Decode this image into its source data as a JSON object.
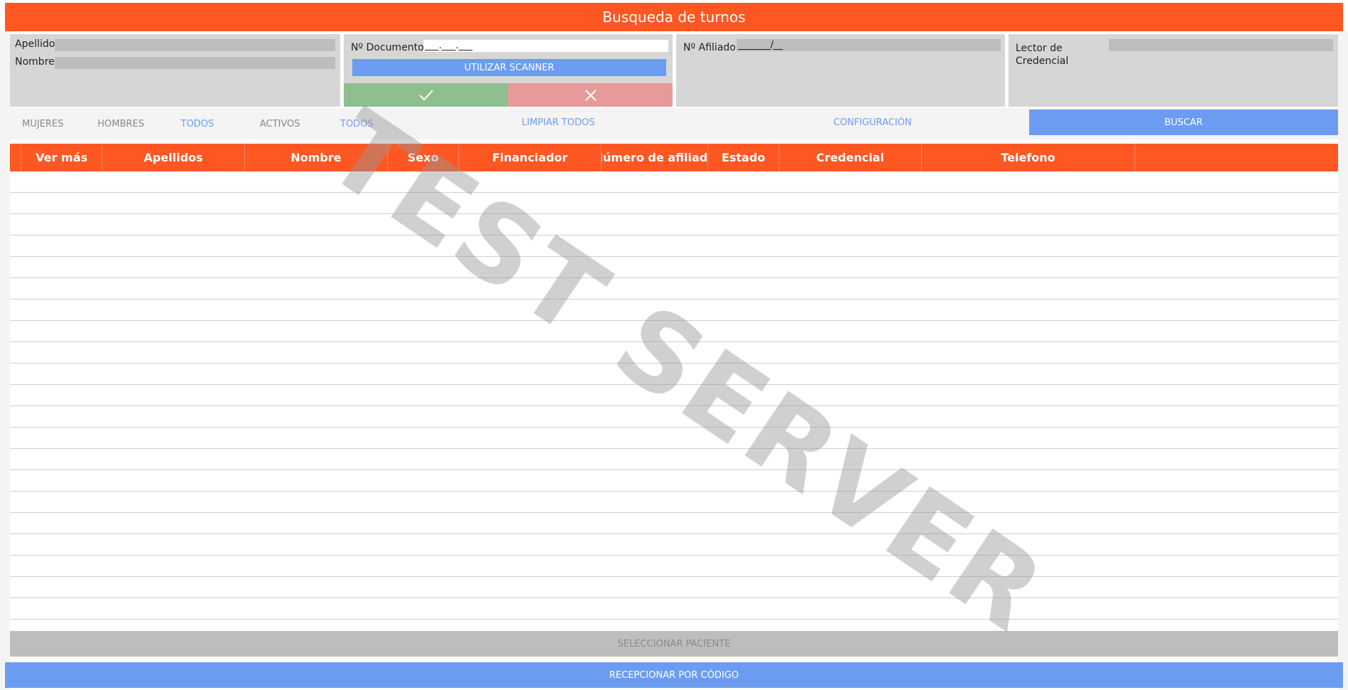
{
  "header": {
    "title": "Busqueda de turnos"
  },
  "name_panel": {
    "apellido_label": "Apellido",
    "apellido_value": "",
    "nombre_label": "Nombre",
    "nombre_value": ""
  },
  "document_panel": {
    "label": "Nº Documento",
    "value": "___.___.___",
    "scanner_button": "UTILIZAR SCANNER",
    "confirm_icon": "check-icon",
    "cancel_icon": "close-icon"
  },
  "affiliate_panel": {
    "label": "Nº Afiliado",
    "value": "_______/__"
  },
  "reader_panel": {
    "label": "Lector de Credencial",
    "value": ""
  },
  "filters": {
    "mujeres": "MUJERES",
    "hombres": "HOMBRES",
    "todos_sexo": "TODOS",
    "activos": "ACTIVOS",
    "todos_estado": "TODOS",
    "clear_all": "LIMPIAR TODOS",
    "config": "CONFIGURACIÓN",
    "search": "BUSCAR"
  },
  "table": {
    "columns": [
      "Ver más",
      "Apellidos",
      "Nombre",
      "Sexo",
      "Financiador",
      "Número de afiliado",
      "Estado",
      "Credencial",
      "Telefono",
      ""
    ],
    "rows": []
  },
  "footer": {
    "select_patient": "SELECCIONAR PACIENTE",
    "receive_by_code": "RECEPCIONAR POR CÓDIGO"
  },
  "watermark": "TEST SERVER",
  "colors": {
    "accent": "#ff5722",
    "primary": "#6b9cf2",
    "panel": "#d6d6d6",
    "confirm": "#8fbf8f",
    "cancel": "#e69a9a"
  }
}
